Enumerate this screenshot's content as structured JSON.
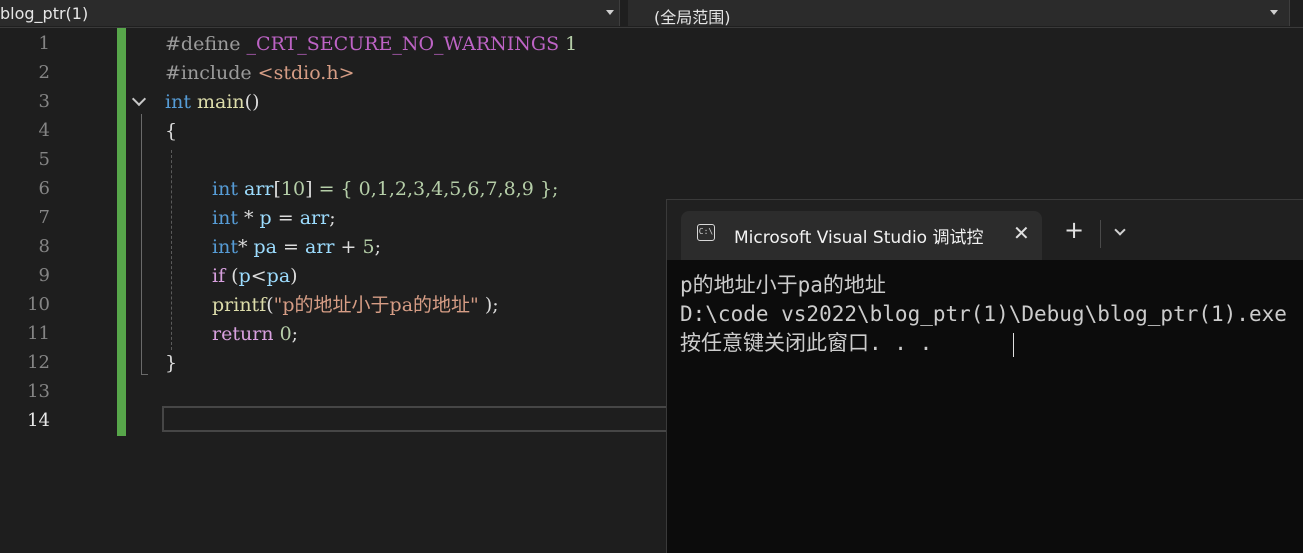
{
  "navbar": {
    "file_combo": "blog_ptr(1)",
    "scope_combo": "(全局范围)"
  },
  "editor": {
    "line_numbers": [
      "1",
      "2",
      "3",
      "4",
      "5",
      "6",
      "7",
      "8",
      "9",
      "10",
      "11",
      "12",
      "13",
      "14"
    ],
    "current_line": "14",
    "code": {
      "l1": {
        "kw": "#define",
        "macro": "_CRT_SECURE_NO_WARNINGS",
        "num": "1"
      },
      "l2": {
        "kw": "#include",
        "header": "<stdio.h>"
      },
      "l3": {
        "type": "int",
        "fn": "main",
        "parens": "()"
      },
      "l4": {
        "brace": "{"
      },
      "l6": {
        "type": "int",
        "var": "arr",
        "bracket_open": "[",
        "size": "10",
        "bracket_close": "]",
        "init": " = { 0,1,2,3,4,5,6,7,8,9 };"
      },
      "l7": {
        "type": "int",
        "star": " * ",
        "var": "p",
        "eq": " = ",
        "rhs": "arr",
        "semi": ";"
      },
      "l8": {
        "type": "int",
        "star": "* ",
        "var": "pa",
        "eq": " = ",
        "rhs": "arr",
        "plus": " + ",
        "num": "5",
        "semi": ";"
      },
      "l9": {
        "kw": "if",
        "open": " (",
        "left": "p",
        "op": "<",
        "right": "pa",
        "close": ")"
      },
      "l10": {
        "fn": "printf",
        "open": "(",
        "str": "\"p的地址小于pa的地址\"",
        "close": " );"
      },
      "l11": {
        "kw": "return",
        "num": "0",
        "semi": ";"
      },
      "l12": {
        "brace": "}"
      }
    }
  },
  "console": {
    "tab_title": "Microsoft Visual Studio 调试控制台",
    "icon_text": "C:\\",
    "close_glyph": "✕",
    "add_glyph": "+",
    "output": [
      "p的地址小于pa的地址",
      "D:\\code vs2022\\blog_ptr(1)\\Debug\\blog_ptr(1).exe",
      "按任意键关闭此窗口. . ."
    ]
  }
}
